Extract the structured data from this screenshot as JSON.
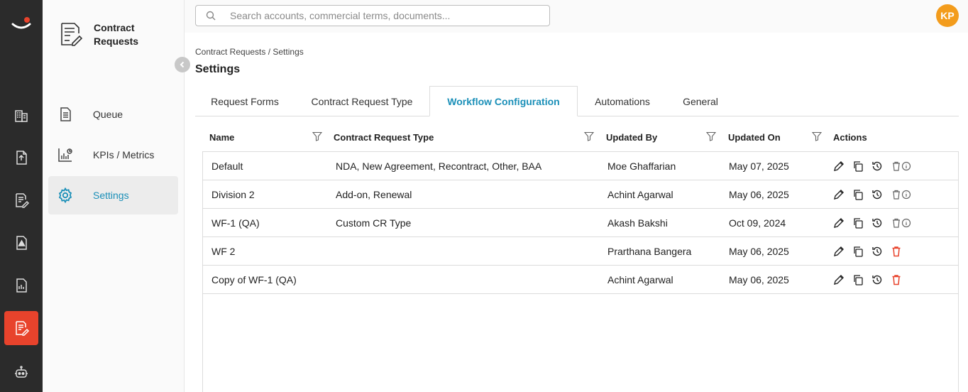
{
  "app": {
    "title": "Contract Requests"
  },
  "search": {
    "placeholder": "Search accounts, commercial terms, documents..."
  },
  "user": {
    "initials": "KP",
    "avatar_color": "#f39c1c"
  },
  "sidebar": {
    "items": [
      {
        "label": "Queue",
        "icon": "document-list-icon"
      },
      {
        "label": "KPIs / Metrics",
        "icon": "metrics-icon"
      },
      {
        "label": "Settings",
        "icon": "gear-icon",
        "active": true
      }
    ]
  },
  "rail": {
    "items": [
      "building-icon",
      "document-upload-icon",
      "document-edit-icon",
      "warning-document-icon",
      "report-icon",
      "contract-request-icon",
      "bot-icon"
    ],
    "active": "contract-request-icon"
  },
  "breadcrumb": {
    "text": "Contract Requests / Settings"
  },
  "page": {
    "title": "Settings"
  },
  "tabs": [
    {
      "label": "Request Forms"
    },
    {
      "label": "Contract Request Type"
    },
    {
      "label": "Workflow Configuration",
      "active": true
    },
    {
      "label": "Automations"
    },
    {
      "label": "General"
    }
  ],
  "table": {
    "columns": [
      "Name",
      "Contract Request Type",
      "Updated By",
      "Updated On",
      "Actions"
    ],
    "rows": [
      {
        "name": "Default",
        "type": "NDA, New Agreement, Recontract, Other, BAA",
        "updated_by": "Moe Ghaffarian",
        "updated_on": "May 07, 2025",
        "delete_enabled": false
      },
      {
        "name": "Division 2",
        "type": "Add-on, Renewal",
        "updated_by": "Achint Agarwal",
        "updated_on": "May 06, 2025",
        "delete_enabled": false
      },
      {
        "name": "WF-1 (QA)",
        "type": "Custom CR Type",
        "updated_by": "Akash Bakshi",
        "updated_on": "Oct 09, 2024",
        "delete_enabled": false
      },
      {
        "name": "WF 2",
        "type": "",
        "updated_by": "Prarthana Bangera",
        "updated_on": "May 06, 2025",
        "delete_enabled": true
      },
      {
        "name": "Copy of WF-1 (QA)",
        "type": "",
        "updated_by": "Achint Agarwal",
        "updated_on": "May 06, 2025",
        "delete_enabled": true
      }
    ]
  },
  "colors": {
    "accent": "#1a8fb8",
    "brand": "#e8432c",
    "delete": "#e8432c"
  }
}
